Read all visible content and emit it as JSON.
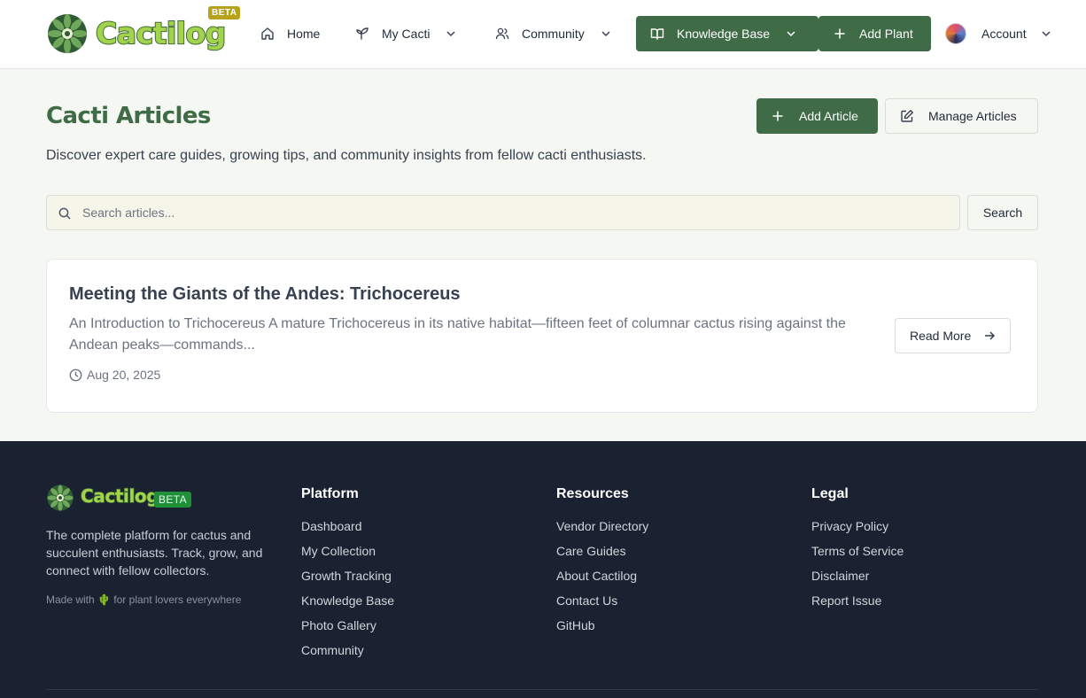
{
  "header": {
    "logo_text": "Cactilog",
    "beta_label": "BETA",
    "nav": {
      "home": "Home",
      "my_cacti": "My Cacti",
      "community": "Community",
      "knowledge_base": "Knowledge Base",
      "add_plant": "Add Plant",
      "account": "Account"
    }
  },
  "main": {
    "title": "Cacti Articles",
    "subtitle": "Discover expert care guides, growing tips, and community insights from fellow cacti enthusiasts.",
    "add_article_label": "Add Article",
    "manage_articles_label": "Manage Articles",
    "search": {
      "placeholder": "Search articles...",
      "value": "",
      "button_label": "Search"
    },
    "articles": [
      {
        "title": "Meeting the Giants of the Andes: Trichocereus",
        "excerpt": "An Introduction to Trichocereus A mature Trichocereus in its native habitat—fifteen feet of columnar cactus rising against the Andean peaks—commands...",
        "date": "Aug 20, 2025",
        "read_more_label": "Read More"
      }
    ]
  },
  "footer": {
    "logo_text": "Cactilog",
    "beta_label": "BETA",
    "description": "The complete platform for cactus and succulent enthusiasts. Track, grow, and connect with fellow collectors.",
    "made_with": "Made with 🌵 for plant lovers everywhere",
    "columns": {
      "platform": {
        "heading": "Platform",
        "links": [
          "Dashboard",
          "My Collection",
          "Growth Tracking",
          "Knowledge Base",
          "Photo Gallery",
          "Community"
        ]
      },
      "resources": {
        "heading": "Resources",
        "links": [
          "Vendor Directory",
          "Care Guides",
          "About Cactilog",
          "Contact Us",
          "GitHub"
        ]
      },
      "legal": {
        "heading": "Legal",
        "links": [
          "Privacy Policy",
          "Terms of Service",
          "Disclaimer",
          "Report Issue"
        ]
      }
    }
  },
  "colors": {
    "brand_green": "#3f6b46",
    "page_bg": "#f5f7f2",
    "footer_bg": "#1a2130",
    "beta_gold": "#b7a21b"
  }
}
